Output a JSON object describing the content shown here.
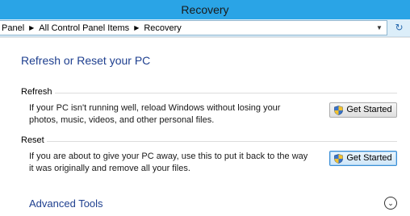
{
  "window": {
    "title": "Recovery"
  },
  "address": {
    "crumbs": [
      "Panel",
      "All Control Panel Items",
      "Recovery"
    ],
    "dropdown_icon": "chevron-down-icon",
    "refresh_icon": "refresh-icon"
  },
  "page": {
    "title": "Refresh or Reset your PC",
    "sections": [
      {
        "header": "Refresh",
        "description": "If your PC isn't running well, reload Windows without losing your photos, music, videos, and other personal files.",
        "button_label": "Get Started"
      },
      {
        "header": "Reset",
        "description": "If you are about to give your PC away, use this to put it back to the way it was originally and remove all your files.",
        "button_label": "Get Started"
      }
    ],
    "advanced_tools": "Advanced Tools",
    "advanced_tools_icon": "chevron-down-circle-icon"
  },
  "colors": {
    "titlebar": "#2aa4e6",
    "link_blue": "#1e3f8f"
  }
}
